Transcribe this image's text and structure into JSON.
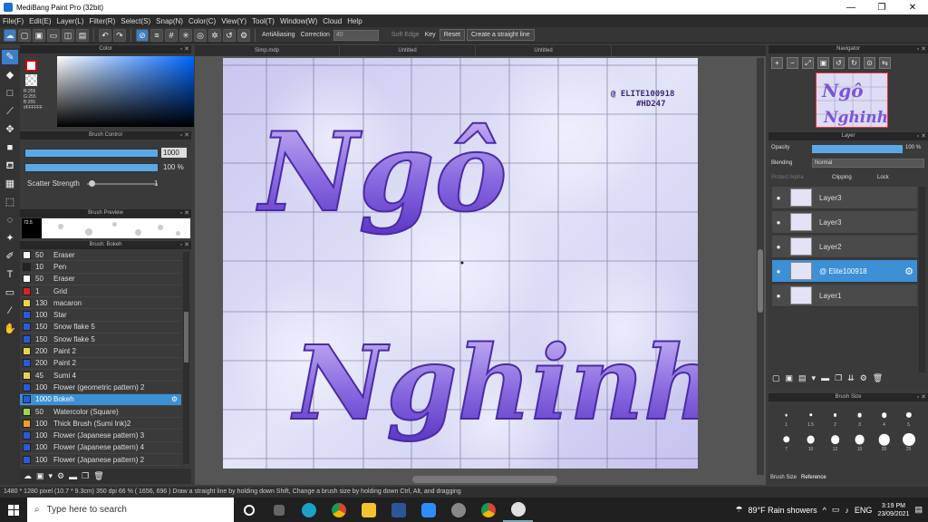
{
  "window": {
    "title": "MediBang Paint Pro (32bit)",
    "min": "—",
    "max": "❐",
    "close": "✕"
  },
  "menu": [
    "File(F)",
    "Edit(E)",
    "Layer(L)",
    "Filter(R)",
    "Select(S)",
    "Snap(N)",
    "Color(C)",
    "View(Y)",
    "Tool(T)",
    "Window(W)",
    "Cloud",
    "Help"
  ],
  "toolbar": {
    "antialias": "AntiAliasing",
    "correction_label": "Correction",
    "correction_value": "40",
    "soft_edge": "Soft Edge",
    "key": "Key",
    "reset": "Reset",
    "straight_line": "Create a straight line"
  },
  "color_panel": {
    "title": "Color",
    "r": "R:255",
    "g": "G:255",
    "b": "B:255",
    "hex": "#FFFFFF"
  },
  "brush_control": {
    "title": "Brush Control",
    "size_value": "1000",
    "opacity_value": "100 %",
    "scatter_label": "Scatter Strength",
    "scatter_value": "1"
  },
  "brush_preview": {
    "title": "Brush Preview",
    "size_tag": "72.5"
  },
  "brush_list": {
    "title": "Brush: Bokeh",
    "items": [
      {
        "size": "50",
        "name": "Eraser",
        "color": "#ffffff"
      },
      {
        "size": "10",
        "name": "Pen",
        "color": "#222222"
      },
      {
        "size": "50",
        "name": "Eraser",
        "color": "#ffffff"
      },
      {
        "size": "1",
        "name": "Grid",
        "color": "#dd2222"
      },
      {
        "size": "130",
        "name": "macaron",
        "color": "#e8d44a"
      },
      {
        "size": "100",
        "name": "Star",
        "color": "#2a5bd7"
      },
      {
        "size": "150",
        "name": "Snow flake 5",
        "color": "#2a5bd7"
      },
      {
        "size": "150",
        "name": "Snow flake 5",
        "color": "#2a5bd7"
      },
      {
        "size": "200",
        "name": "Paint 2",
        "color": "#e8d44a"
      },
      {
        "size": "200",
        "name": "Paint 2",
        "color": "#2a5bd7"
      },
      {
        "size": "45",
        "name": "Sumi 4",
        "color": "#e8d44a"
      },
      {
        "size": "100",
        "name": "Flower (geometric pattern) 2",
        "color": "#2a5bd7"
      },
      {
        "size": "1000",
        "name": "Bokeh",
        "color": "#2a5bd7",
        "selected": true
      },
      {
        "size": "50",
        "name": "Watercolor (Square)",
        "color": "#9fd84a"
      },
      {
        "size": "100",
        "name": "Thick Brush (Sumi Ink)2",
        "color": "#f0a020"
      },
      {
        "size": "100",
        "name": "Flower (Japanese pattern) 3",
        "color": "#2a5bd7"
      },
      {
        "size": "100",
        "name": "Flower (Japanese pattern) 4",
        "color": "#2a5bd7"
      },
      {
        "size": "100",
        "name": "Flower (Japanese pattern) 2",
        "color": "#2a5bd7"
      }
    ]
  },
  "tabs": [
    "Simp.mdp",
    "Untitled",
    "Untitled"
  ],
  "canvas": {
    "line1": "Ngô",
    "line2": "Nghinh",
    "watermark1": "@ ELITE100918",
    "watermark2": "#HD247"
  },
  "navigator": {
    "title": "Navigator"
  },
  "layer_panel": {
    "title": "Layer",
    "opacity_label": "Opacity",
    "opacity_value": "100 %",
    "blending_label": "Blending",
    "blending_value": "Normal",
    "protect_alpha": "Protect Alpha",
    "clipping": "Clipping",
    "lock": "Lock",
    "layers": [
      {
        "name": "Layer3"
      },
      {
        "name": "Layer3"
      },
      {
        "name": "Layer2"
      },
      {
        "name": "@ Elite100918",
        "selected": true
      },
      {
        "name": "Layer1"
      }
    ]
  },
  "brush_size": {
    "title": "Brush Size",
    "tabs": [
      "Brush Size",
      "Reference"
    ],
    "sizes": [
      "1",
      "1.5",
      "2",
      "3",
      "4",
      "5",
      "7",
      "10",
      "12",
      "15",
      "20",
      "25"
    ]
  },
  "status": "1480 * 1280 pixel  (10.7 * 9.3cm)  350 dpi  66 %  ( 1656, 696 )  Draw a straight line by holding down Shift, Change a brush size by holding down Ctrl, Alt, and dragging",
  "taskbar": {
    "search_placeholder": "Type here to search",
    "weather": "89°F  Rain showers",
    "lang": "ENG",
    "time": "3:19 PM",
    "date": "23/09/2021"
  },
  "colors": {
    "accent": "#3d8fd6",
    "purple": "#7b55d6"
  }
}
